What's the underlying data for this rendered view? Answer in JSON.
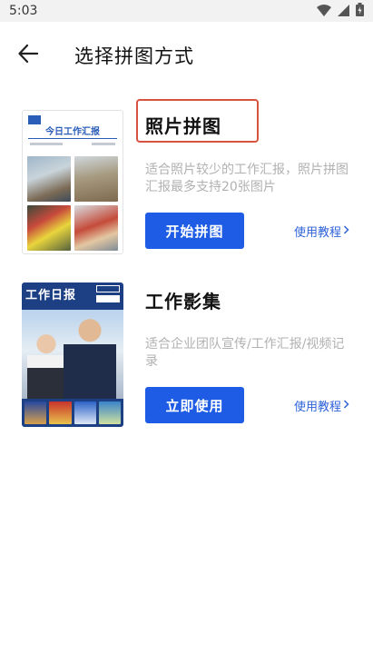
{
  "status_bar": {
    "time": "5:03",
    "icons": [
      "wifi-icon",
      "signal-icon",
      "battery-charging-icon"
    ]
  },
  "header": {
    "title": "选择拼图方式",
    "back_icon": "arrow-left-icon"
  },
  "options": [
    {
      "title": "照片拼图",
      "description": "适合照片较少的工作汇报，照片拼图汇报最多支持20张图片",
      "button_label": "开始拼图",
      "tutorial_label": "使用教程",
      "thumbnail": {
        "heading": "今日工作汇报"
      }
    },
    {
      "title": "工作影集",
      "description": "适合企业团队宣传/工作汇报/视频记录",
      "button_label": "立即使用",
      "tutorial_label": "使用教程",
      "thumbnail": {
        "heading": "工作日报"
      }
    }
  ],
  "colors": {
    "primary": "#1e5ce6",
    "link": "#2d62d8",
    "highlight": "#d8533f",
    "muted_text": "#b1b1b1"
  }
}
